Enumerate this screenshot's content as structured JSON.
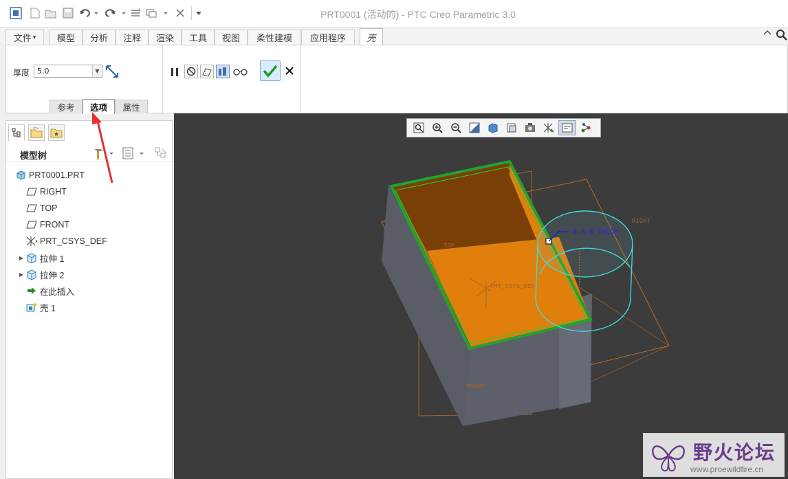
{
  "window": {
    "title": "PRT0001 (活动的) - PTC Creo Parametric 3.0"
  },
  "ribbon_tabs": [
    "文件",
    "模型",
    "分析",
    "注释",
    "渲染",
    "工具",
    "视图",
    "柔性建模",
    "应用程序",
    "壳"
  ],
  "file_tab_arrow": "▾",
  "shell_dashboard": {
    "thickness_label": "厚度",
    "thickness_value": "5.0",
    "subtabs": [
      "参考",
      "选项",
      "属性"
    ],
    "selected_subtab": "选项"
  },
  "model_tree": {
    "title": "模型树",
    "items": [
      {
        "label": "PRT0001.PRT",
        "icon": "part-icon"
      },
      {
        "label": "RIGHT",
        "icon": "datum-plane-icon"
      },
      {
        "label": "TOP",
        "icon": "datum-plane-icon"
      },
      {
        "label": "FRONT",
        "icon": "datum-plane-icon"
      },
      {
        "label": "PRT_CSYS_DEF",
        "icon": "csys-icon"
      },
      {
        "label": "拉伸 1",
        "icon": "extrude-icon"
      },
      {
        "label": "拉伸 2",
        "icon": "extrude-icon"
      },
      {
        "label": "在此插入",
        "icon": "insert-here-icon"
      },
      {
        "label": "壳 1",
        "icon": "shell-icon"
      }
    ]
  },
  "graphics": {
    "dimension_label": "5.0 0_THICK",
    "datum_labels": {
      "right": "RIGHT",
      "top": "TOP",
      "front": "FRONT",
      "csys": "PRT_CSYS_DEF"
    }
  },
  "watermark": {
    "brand": "野火论坛",
    "url": "www.proewildfire.cn"
  },
  "colors": {
    "shell_fill": "#e07f0b",
    "shell_edge": "#1fa332",
    "cylinder_edge": "#3fd9d9",
    "datum_plane": "#a8632a",
    "graphics_bg": "#3c3c3c",
    "annotation_arrow": "#e53030"
  }
}
